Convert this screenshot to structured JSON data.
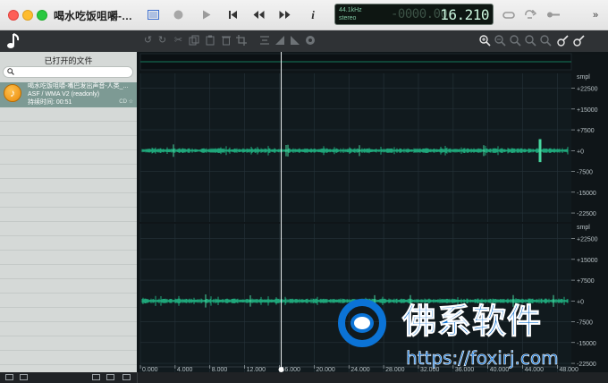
{
  "window": {
    "title": "喝水吃饭咀嚼-嘴巴发出声音-人类..."
  },
  "toolbar": {
    "info_glyph": "i",
    "overflow_glyph": "»"
  },
  "display": {
    "sample_rate": "44.1kHz",
    "channels": "stereo",
    "time_ghost": "-0000.00",
    "time": "16.210"
  },
  "sidebar": {
    "title": "已打开的文件",
    "files": [
      {
        "name": "喝水吃饭咀嚼-嘴巴发出声音-人类_...",
        "format": "ASF / WMA V2 (readonly)",
        "duration": "持续时间: 00:51",
        "badge": "CD ☆"
      }
    ]
  },
  "waveform": {
    "y_unit": "smpl",
    "y_ticks": [
      "+22500",
      "+15000",
      "+7500",
      "+0",
      "-7500",
      "-15000",
      "-22500"
    ],
    "x_ticks": [
      "0.000",
      "4.000",
      "8.000",
      "12.000",
      "16.000",
      "20.000",
      "24.000",
      "28.000",
      "32.000",
      "36.000",
      "40.000",
      "44.000",
      "48.000"
    ],
    "playhead_seconds": 16.21,
    "duration_seconds": 51,
    "channel_count": 2,
    "colors": {
      "wave": "#1fa67a",
      "wave_peak": "#47d79f",
      "background": "#0f1518",
      "grid": "#26333a",
      "ruler": "#b8c2c6"
    }
  },
  "watermark": {
    "brand": "佛系软件",
    "url": "https://foxirj.com"
  }
}
